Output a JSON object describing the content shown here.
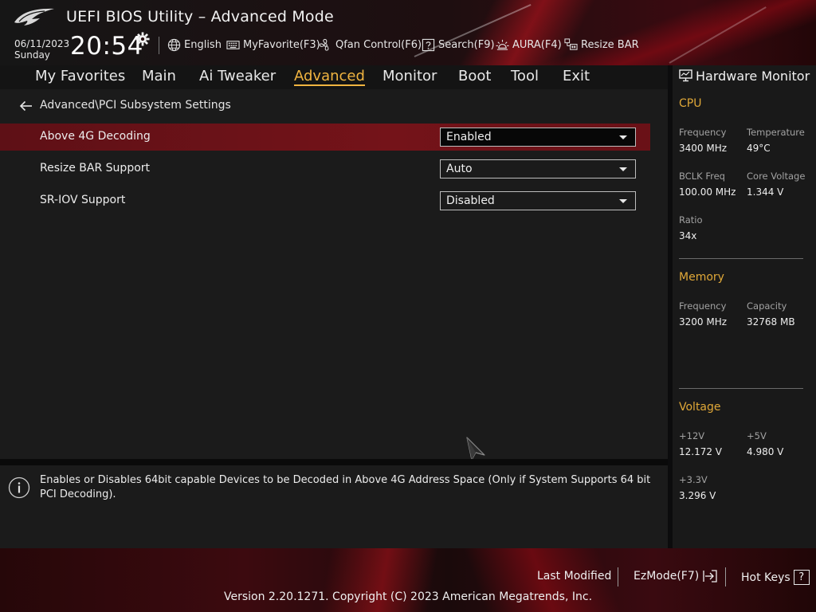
{
  "header": {
    "title": "UEFI BIOS Utility – Advanced Mode",
    "date": "06/11/2023",
    "day": "Sunday",
    "time": "20:54",
    "tools": [
      {
        "label": "English",
        "icon": "globe-icon"
      },
      {
        "label": "MyFavorite(F3)",
        "icon": "keyboard-icon"
      },
      {
        "label": "Qfan Control(F6)",
        "icon": "fan-icon"
      },
      {
        "label": "Search(F9)",
        "icon": "question-box-icon"
      },
      {
        "label": "AURA(F4)",
        "icon": "aura-light-icon"
      },
      {
        "label": "Resize BAR",
        "icon": "resize-bar-icon"
      }
    ]
  },
  "nav": {
    "tabs": [
      "My Favorites",
      "Main",
      "Ai Tweaker",
      "Advanced",
      "Monitor",
      "Boot",
      "Tool",
      "Exit"
    ],
    "active": "Advanced"
  },
  "main": {
    "breadcrumb": "Advanced\\PCI Subsystem Settings",
    "settings": [
      {
        "label": "Above 4G Decoding",
        "value": "Enabled",
        "selected": true
      },
      {
        "label": "Resize BAR Support",
        "value": "Auto",
        "selected": false
      },
      {
        "label": "SR-IOV Support",
        "value": "Disabled",
        "selected": false
      }
    ]
  },
  "help": {
    "text": "Enables or Disables 64bit capable Devices to be Decoded in Above 4G Address Space (Only if System Supports 64 bit PCI Decoding)."
  },
  "hardware_monitor": {
    "title": "Hardware Monitor",
    "cpu": {
      "title": "CPU",
      "frequency_label": "Frequency",
      "frequency": "3400 MHz",
      "temperature_label": "Temperature",
      "temperature": "49°C",
      "bclk_label": "BCLK Freq",
      "bclk": "100.00 MHz",
      "core_voltage_label": "Core Voltage",
      "core_voltage": "1.344 V",
      "ratio_label": "Ratio",
      "ratio": "34x"
    },
    "memory": {
      "title": "Memory",
      "frequency_label": "Frequency",
      "frequency": "3200 MHz",
      "capacity_label": "Capacity",
      "capacity": "32768 MB"
    },
    "voltage": {
      "title": "Voltage",
      "v12_label": "+12V",
      "v12": "12.172 V",
      "v5_label": "+5V",
      "v5": "4.980 V",
      "v33_label": "+3.3V",
      "v33": "3.296 V"
    }
  },
  "footer": {
    "last_modified": "Last Modified",
    "ezmode": "EzMode(F7)",
    "hot_keys": "Hot Keys",
    "hot_keys_key": "?",
    "copyright": "Version 2.20.1271. Copyright (C) 2023 American Megatrends, Inc."
  },
  "colors": {
    "accent": "#f0b440",
    "highlight_row": "#741319",
    "brand_red": "#c8141e"
  }
}
